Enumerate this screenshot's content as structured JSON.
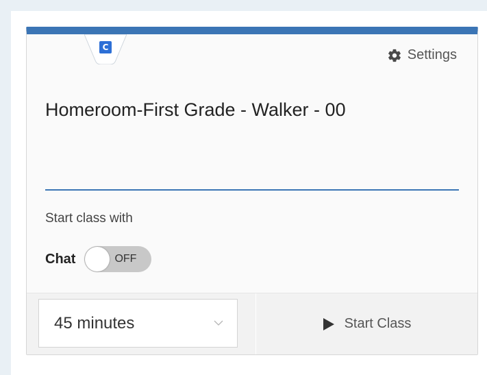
{
  "card": {
    "badge_letter": "C",
    "settings_label": "Settings",
    "title": "Homeroom-First Grade - Walker - 00",
    "start_with_label": "Start class with",
    "chat_label": "Chat",
    "chat_toggle_state": "OFF",
    "duration_value": "45 minutes",
    "start_button_label": "Start Class"
  },
  "colors": {
    "accent": "#3b75b5",
    "badge": "#2d6fd6",
    "toggle_off": "#c8c8c8"
  },
  "icons": {
    "settings": "gear-icon",
    "dropdown": "chevron-down-icon",
    "start": "play-icon"
  }
}
